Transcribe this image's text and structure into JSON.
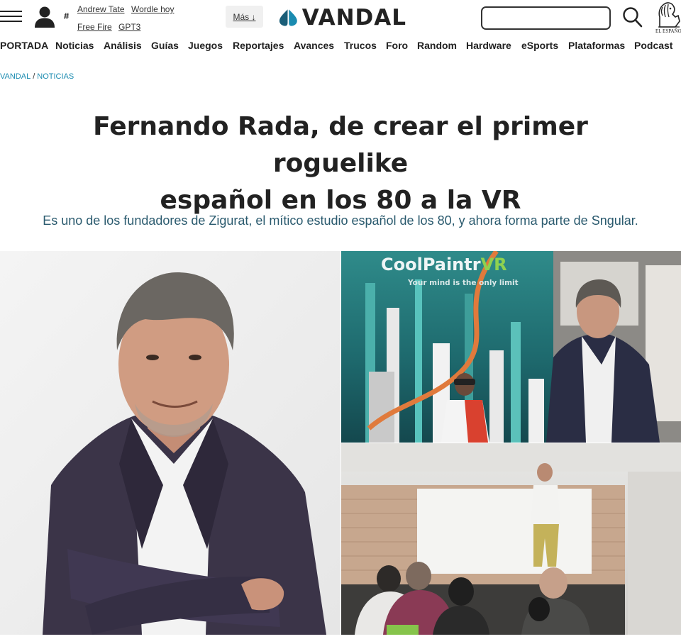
{
  "header": {
    "hash_symbol": "#",
    "trending": [
      "Andrew Tate",
      "Wordle hoy",
      "Free Fire",
      "GPT3"
    ],
    "more_label": "Más ↓",
    "logo_text": "VANDAL",
    "search_placeholder": "",
    "partner_caption": "EL ESPAÑOL"
  },
  "nav": {
    "items": [
      "PORTADA",
      "Noticias",
      "Análisis",
      "Guías",
      "Juegos",
      "Reportajes",
      "Avances",
      "Trucos",
      "Foro",
      "Random",
      "Hardware",
      "eSports",
      "Plataformas",
      "Podcast"
    ]
  },
  "breadcrumb": {
    "items": [
      "VANDAL",
      "NOTICIAS"
    ],
    "separator": "/"
  },
  "article": {
    "title_line1": "Fernando Rada, de crear el primer roguelike",
    "title_line2": "español en los 80 a la VR",
    "subtitle": "Es uno de los fundadores de Zigurat, el mítico estudio español de los 80, y ahora forma parte de Sngular."
  },
  "hero": {
    "vr_title": "CoolPaintr",
    "vr_title_accent": "VR",
    "vr_tagline": "Your mind is the only limit"
  },
  "colors": {
    "brand_blue": "#1a8bb0",
    "text_dark": "#222222",
    "subtitle_teal": "#2a5a6e",
    "vr_green": "#8fd14f"
  }
}
